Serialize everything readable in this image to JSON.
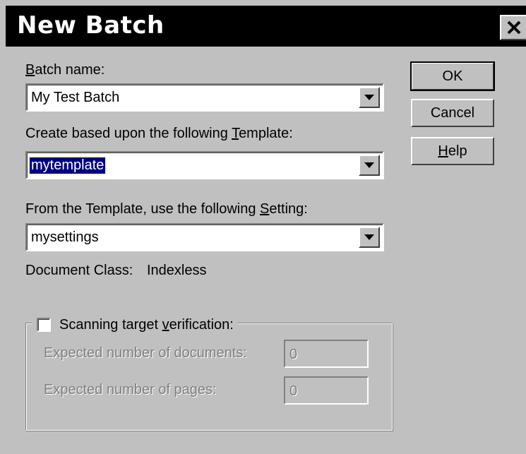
{
  "window": {
    "title": "New Batch",
    "close_symbol": "X"
  },
  "batch_name": {
    "label_prefix": "",
    "label_mnemonic": "B",
    "label_suffix": "atch name:",
    "value": "My Test Batch"
  },
  "template": {
    "label_prefix": "Create based upon the following ",
    "label_mnemonic": "T",
    "label_suffix": "emplate:",
    "value": "mytemplate"
  },
  "setting": {
    "label_prefix": "From the Template, use the following ",
    "label_mnemonic": "S",
    "label_suffix": "etting:",
    "value": "mysettings"
  },
  "document_class": {
    "label": "Document Class:",
    "value": "Indexless"
  },
  "buttons": {
    "ok": "OK",
    "cancel": "Cancel",
    "help_prefix": "",
    "help_mnemonic": "H",
    "help_suffix": "elp"
  },
  "verification": {
    "label_prefix": "Scanning target ",
    "label_mnemonic": "v",
    "label_suffix": "erification:",
    "checked": false,
    "expected_documents_label": "Expected number of documents:",
    "expected_documents_value": "0",
    "expected_pages_label": "Expected number of pages:",
    "expected_pages_value": "0"
  }
}
